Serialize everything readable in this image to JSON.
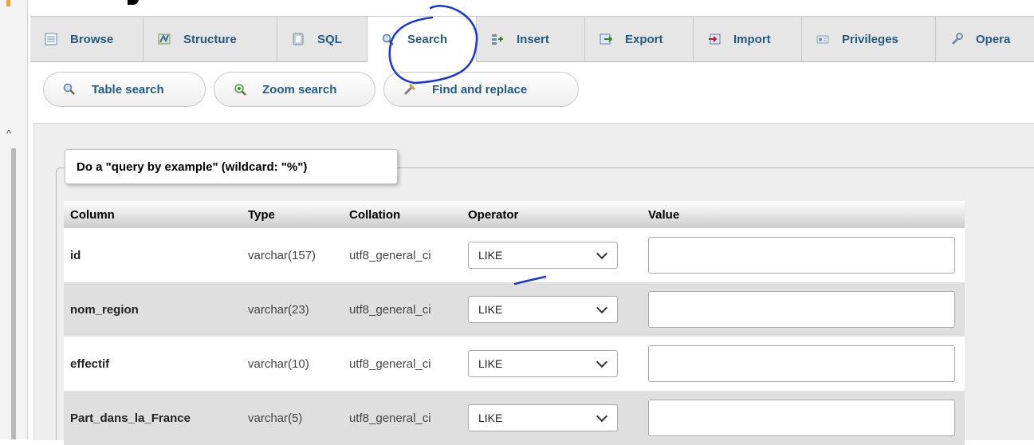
{
  "tabs": [
    {
      "label": "Browse",
      "icon": "browse-icon"
    },
    {
      "label": "Structure",
      "icon": "structure-icon"
    },
    {
      "label": "SQL",
      "icon": "sql-icon"
    },
    {
      "label": "Search",
      "icon": "search-icon",
      "active": true
    },
    {
      "label": "Insert",
      "icon": "insert-icon"
    },
    {
      "label": "Export",
      "icon": "export-icon"
    },
    {
      "label": "Import",
      "icon": "import-icon"
    },
    {
      "label": "Privileges",
      "icon": "privileges-icon"
    },
    {
      "label": "Opera",
      "icon": "operations-icon"
    }
  ],
  "subnav": [
    {
      "label": "Table search",
      "icon": "magnifier-icon"
    },
    {
      "label": "Zoom search",
      "icon": "zoom-icon"
    },
    {
      "label": "Find and replace",
      "icon": "find-replace-icon"
    }
  ],
  "legend": "Do a \"query by example\" (wildcard: \"%\")",
  "table": {
    "headers": [
      "Column",
      "Type",
      "Collation",
      "Operator",
      "Value"
    ],
    "rows": [
      {
        "column": "id",
        "type": "varchar(157)",
        "collation": "utf8_general_ci",
        "operator": "LIKE",
        "value": ""
      },
      {
        "column": "nom_region",
        "type": "varchar(23)",
        "collation": "utf8_general_ci",
        "operator": "LIKE",
        "value": ""
      },
      {
        "column": "effectif",
        "type": "varchar(10)",
        "collation": "utf8_general_ci",
        "operator": "LIKE",
        "value": ""
      },
      {
        "column": "Part_dans_la_France",
        "type": "varchar(5)",
        "collation": "utf8_general_ci",
        "operator": "LIKE",
        "value": ""
      }
    ]
  },
  "colors": {
    "link": "#235a81",
    "annotation": "#1a35d6"
  }
}
